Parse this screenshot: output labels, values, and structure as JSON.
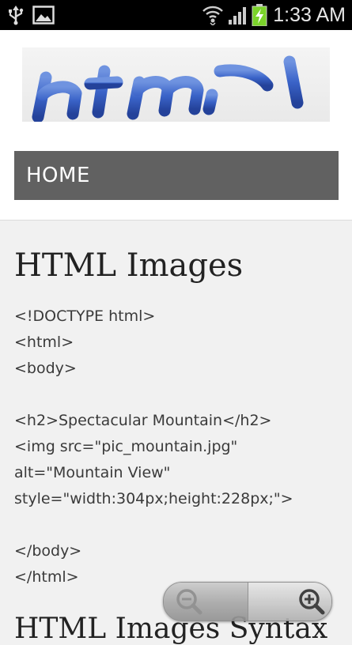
{
  "status_bar": {
    "time": "1:33 AM",
    "icons": [
      "usb-icon",
      "image-icon",
      "wifi-icon",
      "signal-icon",
      "battery-charging-icon"
    ]
  },
  "header": {
    "logo_text": "html",
    "nav": {
      "home_label": "HOME"
    }
  },
  "main": {
    "title": "HTML Images",
    "code_lines": [
      "<!DOCTYPE html>",
      "<html>",
      "<body>",
      "",
      "<h2>Spectacular Mountain</h2>",
      "<img src=\"pic_mountain.jpg\"",
      "alt=\"Mountain View\"",
      "style=\"width:304px;height:228px;\">",
      "",
      "</body>",
      "</html>"
    ],
    "next_section_title": "HTML Images Syntax"
  },
  "zoom_controls": {
    "zoom_out_icon": "zoom-out-icon",
    "zoom_in_icon": "zoom-in-icon"
  },
  "colors": {
    "status_bar_bg": "#000000",
    "nav_bg": "#616161",
    "page_bg": "#f1f1f1",
    "logo_blue": "#3a63c8",
    "battery_green": "#7bd32a"
  }
}
